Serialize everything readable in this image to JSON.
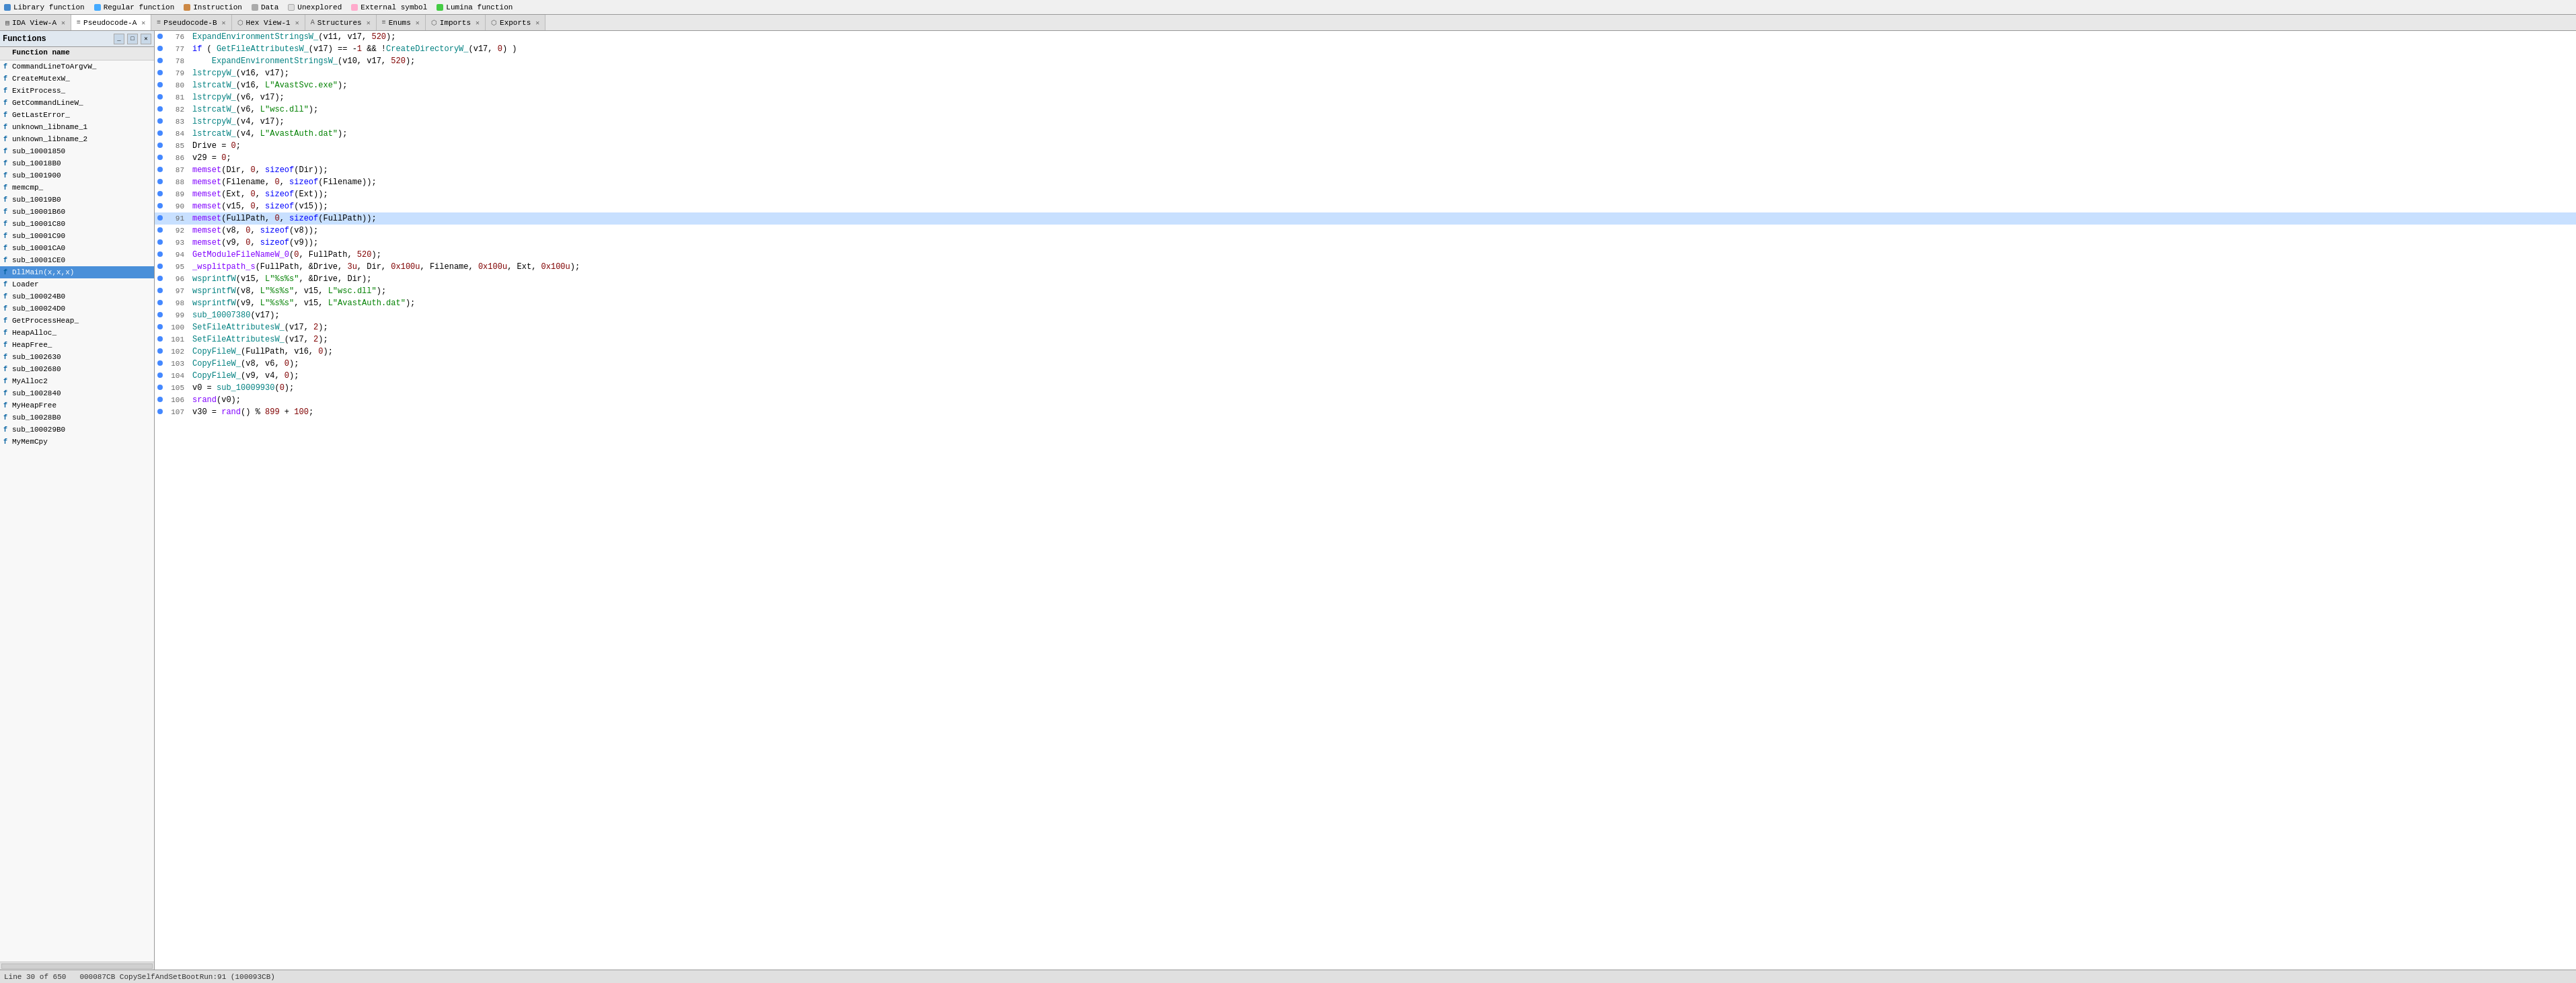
{
  "legend": {
    "items": [
      {
        "label": "Library function",
        "color": "#4488cc"
      },
      {
        "label": "Regular function",
        "color": "#44aaff"
      },
      {
        "label": "Instruction",
        "color": "#cc8844"
      },
      {
        "label": "Data",
        "color": "#aaaaaa"
      },
      {
        "label": "Unexplored",
        "color": "#dddddd"
      },
      {
        "label": "External symbol",
        "color": "#ffaacc"
      },
      {
        "label": "Lumina function",
        "color": "#44cc44"
      }
    ]
  },
  "tabs": [
    {
      "id": "ida-view-a",
      "label": "IDA View-A",
      "icon": "▤",
      "active": false,
      "closable": true
    },
    {
      "id": "pseudocode-a",
      "label": "Pseudocode-A",
      "icon": "≡",
      "active": true,
      "closable": true
    },
    {
      "id": "pseudocode-b",
      "label": "Pseudocode-B",
      "icon": "≡",
      "active": false,
      "closable": true
    },
    {
      "id": "hex-view-1",
      "label": "Hex View-1",
      "icon": "⬡",
      "active": false,
      "closable": true
    },
    {
      "id": "structures",
      "label": "Structures",
      "icon": "A",
      "active": false,
      "closable": true
    },
    {
      "id": "enums",
      "label": "Enums",
      "icon": "≡",
      "active": false,
      "closable": true
    },
    {
      "id": "imports",
      "label": "Imports",
      "icon": "⬡",
      "active": false,
      "closable": true
    },
    {
      "id": "exports",
      "label": "Exports",
      "icon": "⬡",
      "active": false,
      "closable": true
    }
  ],
  "functions_panel": {
    "title": "Functions",
    "header": "Function name",
    "items": [
      {
        "name": "CommandLineToArgvW_",
        "selected": false
      },
      {
        "name": "CreateMutexW_",
        "selected": false
      },
      {
        "name": "ExitProcess_",
        "selected": false
      },
      {
        "name": "GetCommandLineW_",
        "selected": false
      },
      {
        "name": "GetLastError_",
        "selected": false
      },
      {
        "name": "unknown_libname_1",
        "selected": false
      },
      {
        "name": "unknown_libname_2",
        "selected": false
      },
      {
        "name": "sub_10001850",
        "selected": false
      },
      {
        "name": "sub_10018B0",
        "selected": false
      },
      {
        "name": "sub_1001900",
        "selected": false
      },
      {
        "name": "memcmp_",
        "selected": false
      },
      {
        "name": "sub_10019B0",
        "selected": false
      },
      {
        "name": "sub_10001B60",
        "selected": false
      },
      {
        "name": "sub_10001C80",
        "selected": false
      },
      {
        "name": "sub_10001C90",
        "selected": false
      },
      {
        "name": "sub_10001CA0",
        "selected": false
      },
      {
        "name": "sub_10001CE0",
        "selected": false
      },
      {
        "name": "DllMain(x,x,x)",
        "selected": true
      },
      {
        "name": "Loader",
        "selected": false
      },
      {
        "name": "sub_100024B0",
        "selected": false
      },
      {
        "name": "sub_100024D0",
        "selected": false
      },
      {
        "name": "GetProcessHeap_",
        "selected": false
      },
      {
        "name": "HeapAlloc_",
        "selected": false
      },
      {
        "name": "HeapFree_",
        "selected": false
      },
      {
        "name": "sub_1002630",
        "selected": false
      },
      {
        "name": "sub_1002680",
        "selected": false
      },
      {
        "name": "MyAlloc2",
        "selected": false
      },
      {
        "name": "sub_1002840",
        "selected": false
      },
      {
        "name": "MyHeapFree",
        "selected": false
      },
      {
        "name": "sub_10028B0",
        "selected": false
      },
      {
        "name": "sub_100029B0",
        "selected": false
      },
      {
        "name": "MyMemCpy",
        "selected": false
      }
    ]
  },
  "code": {
    "lines": [
      {
        "num": 76,
        "dot": true,
        "highlighted": false,
        "text": "ExpandEnvironmentStringsW_(v11, v17, 520);"
      },
      {
        "num": 77,
        "dot": true,
        "highlighted": false,
        "text": "if ( GetFileAttributesW_(v17) == -1 && !CreateDirectoryW_(v17, 0) )"
      },
      {
        "num": 78,
        "dot": true,
        "highlighted": false,
        "text": "    ExpandEnvironmentStringsW_(v10, v17, 520);"
      },
      {
        "num": 79,
        "dot": true,
        "highlighted": false,
        "text": "lstrcpyW_(v16, v17);"
      },
      {
        "num": 80,
        "dot": true,
        "highlighted": false,
        "text": "lstrcatW_(v16, L\"AvastSvc.exe\");"
      },
      {
        "num": 81,
        "dot": true,
        "highlighted": false,
        "text": "lstrcpyW_(v6, v17);"
      },
      {
        "num": 82,
        "dot": true,
        "highlighted": false,
        "text": "lstrcatW_(v6, L\"wsc.dll\");"
      },
      {
        "num": 83,
        "dot": true,
        "highlighted": false,
        "text": "lstrcpyW_(v4, v17);"
      },
      {
        "num": 84,
        "dot": true,
        "highlighted": false,
        "text": "lstrcatW_(v4, L\"AvastAuth.dat\");"
      },
      {
        "num": 85,
        "dot": true,
        "highlighted": false,
        "text": "Drive = 0;"
      },
      {
        "num": 86,
        "dot": true,
        "highlighted": false,
        "text": "v29 = 0;"
      },
      {
        "num": 87,
        "dot": true,
        "highlighted": false,
        "text": "memset(Dir, 0, sizeof(Dir));"
      },
      {
        "num": 88,
        "dot": true,
        "highlighted": false,
        "text": "memset(Filename, 0, sizeof(Filename));"
      },
      {
        "num": 89,
        "dot": true,
        "highlighted": false,
        "text": "memset(Ext, 0, sizeof(Ext));"
      },
      {
        "num": 90,
        "dot": true,
        "highlighted": false,
        "text": "memset(v15, 0, sizeof(v15));"
      },
      {
        "num": 91,
        "dot": true,
        "highlighted": true,
        "text": "memset(FullPath, 0, sizeof(FullPath));"
      },
      {
        "num": 92,
        "dot": true,
        "highlighted": false,
        "text": "memset(v8, 0, sizeof(v8));"
      },
      {
        "num": 93,
        "dot": true,
        "highlighted": false,
        "text": "memset(v9, 0, sizeof(v9));"
      },
      {
        "num": 94,
        "dot": true,
        "highlighted": false,
        "text": "GetModuleFileNameW_0(0, FullPath, 520);"
      },
      {
        "num": 95,
        "dot": true,
        "highlighted": false,
        "text": "_wsplitpath_s(FullPath, &Drive, 3u, Dir, 0x100u, Filename, 0x100u, Ext, 0x100u);"
      },
      {
        "num": 96,
        "dot": true,
        "highlighted": false,
        "text": "wsprintfW(v15, L\"%s%s\", &Drive, Dir);"
      },
      {
        "num": 97,
        "dot": true,
        "highlighted": false,
        "text": "wsprintfW(v8, L\"%s%s\", v15, L\"wsc.dll\");"
      },
      {
        "num": 98,
        "dot": true,
        "highlighted": false,
        "text": "wsprintfW(v9, L\"%s%s\", v15, L\"AvastAuth.dat\");"
      },
      {
        "num": 99,
        "dot": true,
        "highlighted": false,
        "text": "sub_10007380(v17);"
      },
      {
        "num": 100,
        "dot": true,
        "highlighted": false,
        "text": "SetFileAttributesW_(v17, 2);"
      },
      {
        "num": 101,
        "dot": true,
        "highlighted": false,
        "text": "SetFileAttributesW_(v17, 2);"
      },
      {
        "num": 102,
        "dot": true,
        "highlighted": false,
        "text": "CopyFileW_(FullPath, v16, 0);"
      },
      {
        "num": 103,
        "dot": true,
        "highlighted": false,
        "text": "CopyFileW_(v8, v6, 0);"
      },
      {
        "num": 104,
        "dot": true,
        "highlighted": false,
        "text": "CopyFileW_(v9, v4, 0);"
      },
      {
        "num": 105,
        "dot": true,
        "highlighted": false,
        "text": "v0 = sub_10009930(0);"
      },
      {
        "num": 106,
        "dot": true,
        "highlighted": false,
        "text": "srand(v0);"
      },
      {
        "num": 107,
        "dot": true,
        "highlighted": false,
        "text": "v30 = rand() % 899 + 100;"
      }
    ]
  },
  "status": {
    "line_info": "Line 30 of 650",
    "address_info": "000087CB CopySelfAndSetBootRun:91 (100093CB)"
  }
}
